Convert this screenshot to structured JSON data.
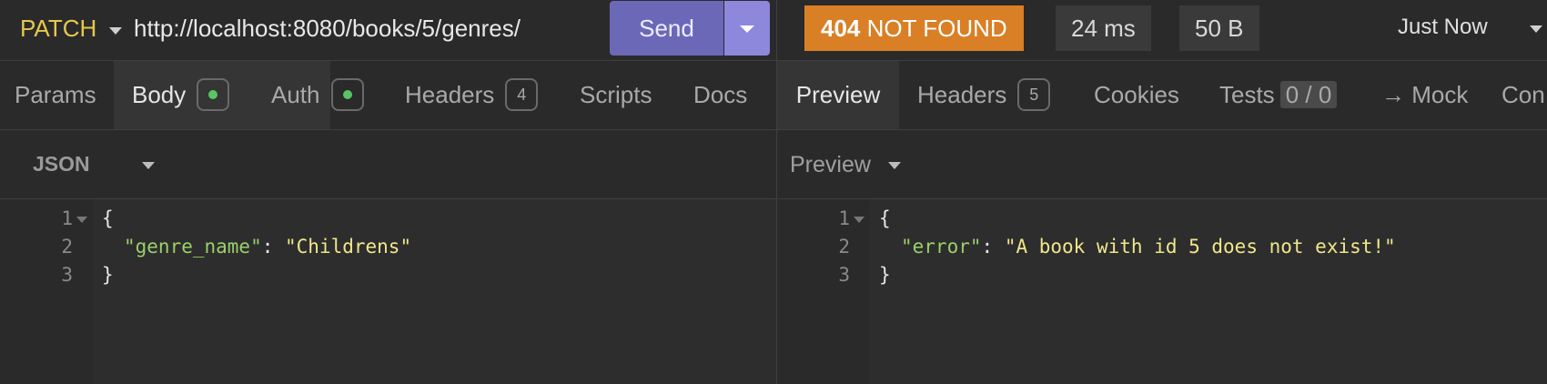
{
  "request": {
    "method": "PATCH",
    "url": "http://localhost:8080/books/5/genres/",
    "send_label": "Send"
  },
  "request_tabs": [
    {
      "label": "Params"
    },
    {
      "label": "Body",
      "indicator": "dot"
    },
    {
      "label": "Auth",
      "indicator": "dot"
    },
    {
      "label": "Headers",
      "count": "4"
    },
    {
      "label": "Scripts"
    },
    {
      "label": "Docs"
    }
  ],
  "body": {
    "format": "JSON",
    "lines": [
      {
        "num": "1",
        "text": "{"
      },
      {
        "num": "2",
        "key": "\"genre_name\"",
        "sep": ": ",
        "value": "\"Childrens\""
      },
      {
        "num": "3",
        "text": "}"
      }
    ]
  },
  "response": {
    "status_code": "404",
    "status_text": "NOT FOUND",
    "time": "24 ms",
    "size": "50 B",
    "history": "Just Now",
    "status_color": "#d97f25"
  },
  "response_tabs": [
    {
      "label": "Preview"
    },
    {
      "label": "Headers",
      "count": "5"
    },
    {
      "label": "Cookies"
    },
    {
      "label": "Tests",
      "count": "0 / 0"
    },
    {
      "label": "→ Mock"
    },
    {
      "label": "Con"
    }
  ],
  "preview": {
    "mode": "Preview",
    "lines": [
      {
        "num": "1",
        "text": "{"
      },
      {
        "num": "2",
        "key": "\"error\"",
        "sep": ": ",
        "value": "\"A book with id 5 does not exist!\""
      },
      {
        "num": "3",
        "text": "}"
      }
    ]
  },
  "colors": {
    "send": "#6c68b8",
    "method": "#e6c84c",
    "json_key": "#9ad06a",
    "json_string": "#f0e68c",
    "status_dot": "#5ac466"
  }
}
